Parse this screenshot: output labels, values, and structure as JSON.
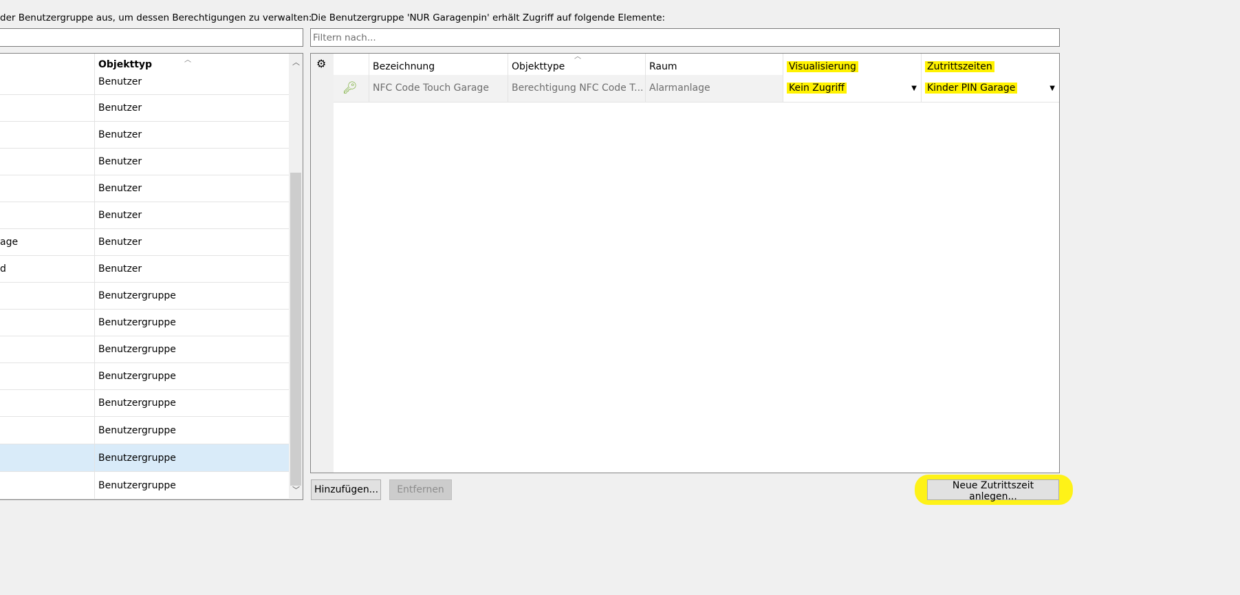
{
  "left_label": "der Benutzergruppe aus, um dessen Berechtigungen zu verwalten:",
  "right_label": "Die Benutzergruppe 'NUR Garagenpin' erhält Zugriff auf folgende Elemente:",
  "left_search": {
    "value": ""
  },
  "right_filter": {
    "placeholder": "Filtern nach..."
  },
  "left_table": {
    "header": {
      "col2": "Objekttyp"
    },
    "rows": [
      {
        "name": "",
        "type": "Benutzer"
      },
      {
        "name": "",
        "type": "Benutzer"
      },
      {
        "name": "",
        "type": "Benutzer"
      },
      {
        "name": "",
        "type": "Benutzer"
      },
      {
        "name": "",
        "type": "Benutzer"
      },
      {
        "name": "",
        "type": "Benutzer"
      },
      {
        "name": "age",
        "type": "Benutzer"
      },
      {
        "name": "d",
        "type": "Benutzer"
      },
      {
        "name": "",
        "type": "Benutzergruppe"
      },
      {
        "name": "",
        "type": "Benutzergruppe"
      },
      {
        "name": "",
        "type": "Benutzergruppe"
      },
      {
        "name": "",
        "type": "Benutzergruppe"
      },
      {
        "name": "",
        "type": "Benutzergruppe"
      },
      {
        "name": "",
        "type": "Benutzergruppe"
      },
      {
        "name": "",
        "type": "Benutzergruppe",
        "selected": true
      },
      {
        "name": "",
        "type": "Benutzergruppe"
      }
    ]
  },
  "right_table": {
    "headers": [
      "Bezeichnung",
      "Objekttype",
      "Raum",
      "Visualisierung",
      "Zutrittszeiten"
    ],
    "row": {
      "bezeichnung": "NFC Code Touch Garage",
      "objekttype": "Berechtigung NFC Code T...",
      "raum": "Alarmanlage",
      "visualisierung": "Kein Zugriff",
      "zutrittszeiten": "Kinder PIN Garage"
    }
  },
  "buttons": {
    "add": "Hinzufügen...",
    "remove": "Entfernen",
    "new_access_time": "Neue Zutrittszeit anlegen..."
  },
  "colors": {
    "highlight": "#fff200",
    "selected_row": "#d9ebf9",
    "key_icon": "#6aa51f"
  }
}
